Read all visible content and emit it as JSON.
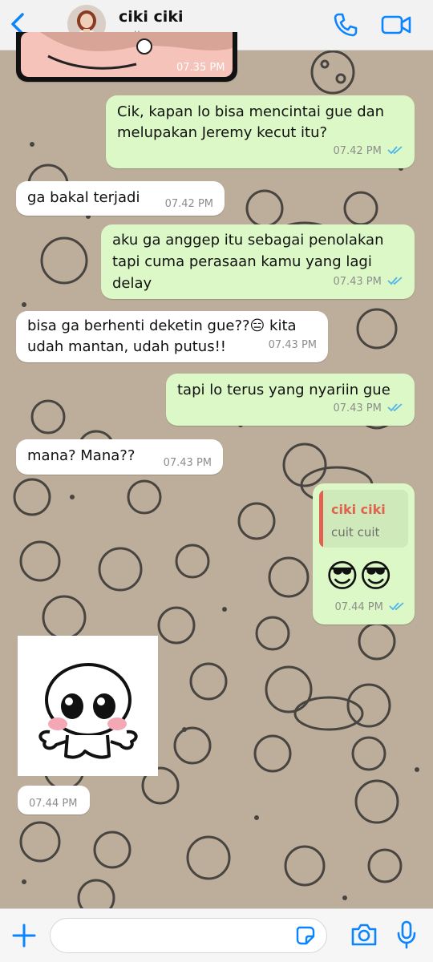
{
  "header": {
    "contact_name": "ciki ciki",
    "status": "online"
  },
  "messages": [
    {
      "direction": "in",
      "type": "image",
      "time": "07.35 PM"
    },
    {
      "direction": "out",
      "lines": [
        "Cik, kapan lo bisa mencintai gue dan",
        "melupakan Jeremy kecut itu?"
      ],
      "time": "07.42 PM",
      "read": true
    },
    {
      "direction": "in",
      "lines": [
        "ga bakal terjadi"
      ],
      "time": "07.42 PM"
    },
    {
      "direction": "out",
      "lines": [
        "aku ga anggep itu sebagai penolakan",
        "tapi cuma perasaan kamu yang lagi",
        "delay"
      ],
      "time": "07.43 PM",
      "read": true
    },
    {
      "direction": "in",
      "lines": [
        "bisa ga berhenti deketin gue??😑 kita",
        "udah mantan, udah putus!!"
      ],
      "time": "07.43 PM"
    },
    {
      "direction": "out",
      "lines": [
        "tapi lo terus yang nyariin gue"
      ],
      "time": "07.43 PM",
      "read": true
    },
    {
      "direction": "in",
      "lines": [
        "mana? Mana??"
      ],
      "time": "07.43 PM"
    },
    {
      "direction": "out",
      "reply_to": {
        "author": "ciki ciki",
        "text": "cuit cuit"
      },
      "emoji": "😎😎",
      "time": "07.44 PM",
      "read": true
    },
    {
      "direction": "in",
      "type": "sticker",
      "time": "07.44 PM"
    }
  ],
  "colors": {
    "accent": "#0a84ff",
    "outgoing": "#dcf8c6",
    "incoming": "#ffffff",
    "read_ticks": "#4fb6ec",
    "reply_author": "#e0634f"
  },
  "footer": {
    "icons": [
      "plus-icon",
      "sticker-icon",
      "camera-icon",
      "microphone-icon"
    ]
  }
}
